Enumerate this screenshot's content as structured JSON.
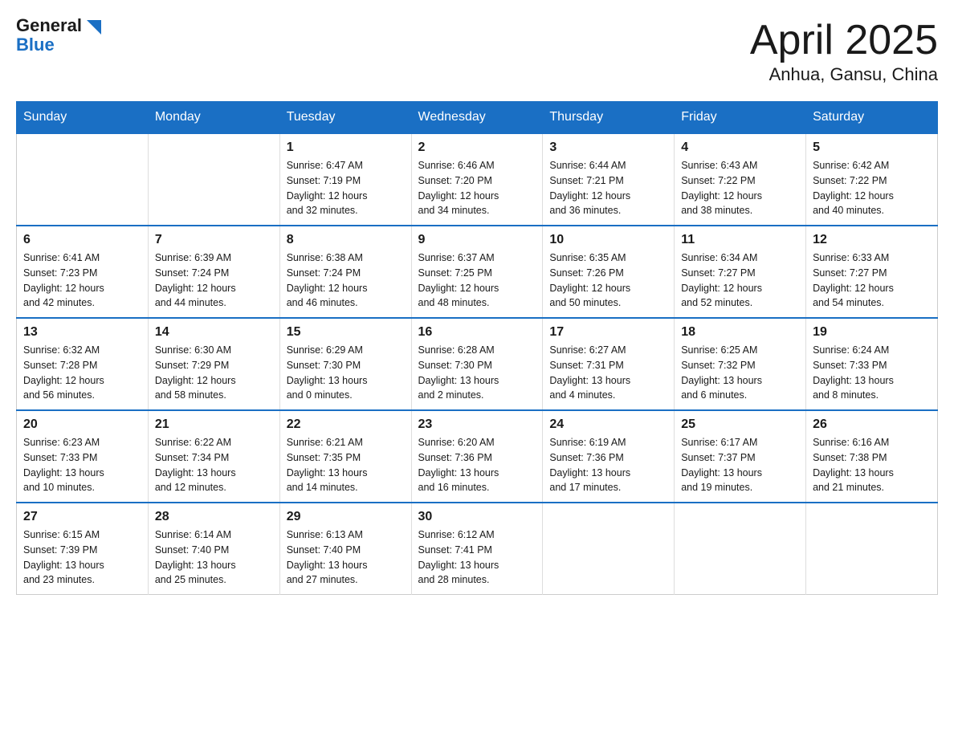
{
  "header": {
    "logo": {
      "general": "General",
      "blue": "Blue"
    },
    "title": "April 2025",
    "subtitle": "Anhua, Gansu, China"
  },
  "days_of_week": [
    "Sunday",
    "Monday",
    "Tuesday",
    "Wednesday",
    "Thursday",
    "Friday",
    "Saturday"
  ],
  "weeks": [
    [
      {
        "day": "",
        "info": ""
      },
      {
        "day": "",
        "info": ""
      },
      {
        "day": "1",
        "info": "Sunrise: 6:47 AM\nSunset: 7:19 PM\nDaylight: 12 hours\nand 32 minutes."
      },
      {
        "day": "2",
        "info": "Sunrise: 6:46 AM\nSunset: 7:20 PM\nDaylight: 12 hours\nand 34 minutes."
      },
      {
        "day": "3",
        "info": "Sunrise: 6:44 AM\nSunset: 7:21 PM\nDaylight: 12 hours\nand 36 minutes."
      },
      {
        "day": "4",
        "info": "Sunrise: 6:43 AM\nSunset: 7:22 PM\nDaylight: 12 hours\nand 38 minutes."
      },
      {
        "day": "5",
        "info": "Sunrise: 6:42 AM\nSunset: 7:22 PM\nDaylight: 12 hours\nand 40 minutes."
      }
    ],
    [
      {
        "day": "6",
        "info": "Sunrise: 6:41 AM\nSunset: 7:23 PM\nDaylight: 12 hours\nand 42 minutes."
      },
      {
        "day": "7",
        "info": "Sunrise: 6:39 AM\nSunset: 7:24 PM\nDaylight: 12 hours\nand 44 minutes."
      },
      {
        "day": "8",
        "info": "Sunrise: 6:38 AM\nSunset: 7:24 PM\nDaylight: 12 hours\nand 46 minutes."
      },
      {
        "day": "9",
        "info": "Sunrise: 6:37 AM\nSunset: 7:25 PM\nDaylight: 12 hours\nand 48 minutes."
      },
      {
        "day": "10",
        "info": "Sunrise: 6:35 AM\nSunset: 7:26 PM\nDaylight: 12 hours\nand 50 minutes."
      },
      {
        "day": "11",
        "info": "Sunrise: 6:34 AM\nSunset: 7:27 PM\nDaylight: 12 hours\nand 52 minutes."
      },
      {
        "day": "12",
        "info": "Sunrise: 6:33 AM\nSunset: 7:27 PM\nDaylight: 12 hours\nand 54 minutes."
      }
    ],
    [
      {
        "day": "13",
        "info": "Sunrise: 6:32 AM\nSunset: 7:28 PM\nDaylight: 12 hours\nand 56 minutes."
      },
      {
        "day": "14",
        "info": "Sunrise: 6:30 AM\nSunset: 7:29 PM\nDaylight: 12 hours\nand 58 minutes."
      },
      {
        "day": "15",
        "info": "Sunrise: 6:29 AM\nSunset: 7:30 PM\nDaylight: 13 hours\nand 0 minutes."
      },
      {
        "day": "16",
        "info": "Sunrise: 6:28 AM\nSunset: 7:30 PM\nDaylight: 13 hours\nand 2 minutes."
      },
      {
        "day": "17",
        "info": "Sunrise: 6:27 AM\nSunset: 7:31 PM\nDaylight: 13 hours\nand 4 minutes."
      },
      {
        "day": "18",
        "info": "Sunrise: 6:25 AM\nSunset: 7:32 PM\nDaylight: 13 hours\nand 6 minutes."
      },
      {
        "day": "19",
        "info": "Sunrise: 6:24 AM\nSunset: 7:33 PM\nDaylight: 13 hours\nand 8 minutes."
      }
    ],
    [
      {
        "day": "20",
        "info": "Sunrise: 6:23 AM\nSunset: 7:33 PM\nDaylight: 13 hours\nand 10 minutes."
      },
      {
        "day": "21",
        "info": "Sunrise: 6:22 AM\nSunset: 7:34 PM\nDaylight: 13 hours\nand 12 minutes."
      },
      {
        "day": "22",
        "info": "Sunrise: 6:21 AM\nSunset: 7:35 PM\nDaylight: 13 hours\nand 14 minutes."
      },
      {
        "day": "23",
        "info": "Sunrise: 6:20 AM\nSunset: 7:36 PM\nDaylight: 13 hours\nand 16 minutes."
      },
      {
        "day": "24",
        "info": "Sunrise: 6:19 AM\nSunset: 7:36 PM\nDaylight: 13 hours\nand 17 minutes."
      },
      {
        "day": "25",
        "info": "Sunrise: 6:17 AM\nSunset: 7:37 PM\nDaylight: 13 hours\nand 19 minutes."
      },
      {
        "day": "26",
        "info": "Sunrise: 6:16 AM\nSunset: 7:38 PM\nDaylight: 13 hours\nand 21 minutes."
      }
    ],
    [
      {
        "day": "27",
        "info": "Sunrise: 6:15 AM\nSunset: 7:39 PM\nDaylight: 13 hours\nand 23 minutes."
      },
      {
        "day": "28",
        "info": "Sunrise: 6:14 AM\nSunset: 7:40 PM\nDaylight: 13 hours\nand 25 minutes."
      },
      {
        "day": "29",
        "info": "Sunrise: 6:13 AM\nSunset: 7:40 PM\nDaylight: 13 hours\nand 27 minutes."
      },
      {
        "day": "30",
        "info": "Sunrise: 6:12 AM\nSunset: 7:41 PM\nDaylight: 13 hours\nand 28 minutes."
      },
      {
        "day": "",
        "info": ""
      },
      {
        "day": "",
        "info": ""
      },
      {
        "day": "",
        "info": ""
      }
    ]
  ]
}
